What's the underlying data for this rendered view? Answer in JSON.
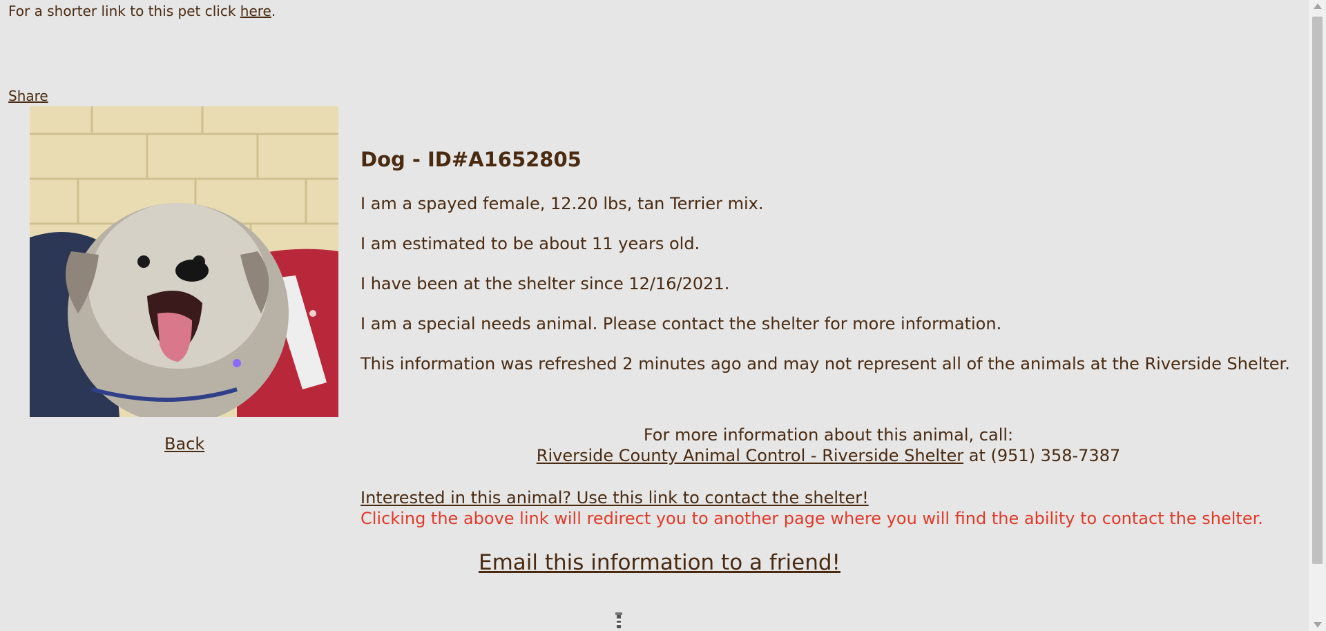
{
  "top": {
    "shorter_link_prefix": "For a shorter link to this pet click",
    "shorter_link_text": "here",
    "shorter_link_suffix": "."
  },
  "share_label": "Share",
  "back_label": "Back",
  "animal": {
    "title": "Dog - ID#A1652805",
    "description_1": "I am a spayed female, 12.20 lbs, tan Terrier mix.",
    "description_2": "I am estimated to be about 11 years old.",
    "description_3": "I have been at the shelter since 12/16/2021.",
    "description_4": "I am a special needs animal. Please contact the shelter for more information.",
    "refresh_note": "This information was refreshed 2 minutes ago and may not represent all of the animals at the Riverside Shelter."
  },
  "contact": {
    "call_prompt": "For more information about this animal, call:",
    "shelter_name": "Riverside County Animal Control - Riverside Shelter",
    "phone_prefix": "at",
    "phone": "(951) 358-7387"
  },
  "interest": {
    "link_text": "Interested in this animal? Use this link to contact the shelter!",
    "redirect_note": "Clicking the above link will redirect you to another page where you will find the ability to contact the shelter."
  },
  "email_label": "Email this information to a friend!",
  "colors": {
    "background": "#e6e6e6",
    "text": "#4a2a10",
    "warning": "#e03a2a"
  }
}
